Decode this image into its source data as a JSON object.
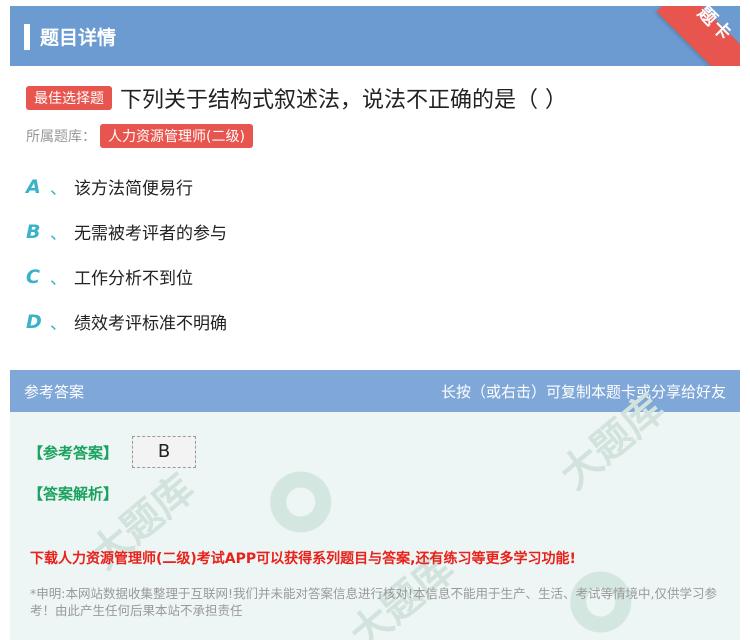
{
  "header": {
    "title": "题目详情",
    "ribbon": "题卡"
  },
  "question": {
    "badge": "最佳选择题",
    "text": "下列关于结构式叙述法，说法不正确的是（ ）",
    "bank_label": "所属题库：",
    "bank_name": "人力资源管理师(二级)"
  },
  "options": [
    {
      "letter": "A",
      "sep": "、",
      "text": "该方法简便易行"
    },
    {
      "letter": "B",
      "sep": "、",
      "text": "无需被考评者的参与"
    },
    {
      "letter": "C",
      "sep": "、",
      "text": "工作分析不到位"
    },
    {
      "letter": "D",
      "sep": "、",
      "text": "绩效考评标准不明确"
    }
  ],
  "answer": {
    "section_title": "参考答案",
    "share_hint": "长按（或右击）可复制本题卡或分享给好友",
    "answer_label": "【参考答案】",
    "answer_value": "B",
    "analysis_label": "【答案解析】",
    "promo": "下载人力资源管理师(二级)考试APP可以获得系列题目与答案,还有练习等更多学习功能!",
    "disclaimer": "*申明:本网站数据收集整理于互联网!我们并未能对答案信息进行核对!本信息不能用于生产、生活、考试等情境中,仅供学习参考！由此产生任何后果本站不承担责任"
  },
  "colors": {
    "header_bg": "#6b9bd1",
    "badge": "#e8554e",
    "option_letter": "#3ab3c9",
    "answer_label": "#19a35e",
    "promo": "#e8211a"
  }
}
